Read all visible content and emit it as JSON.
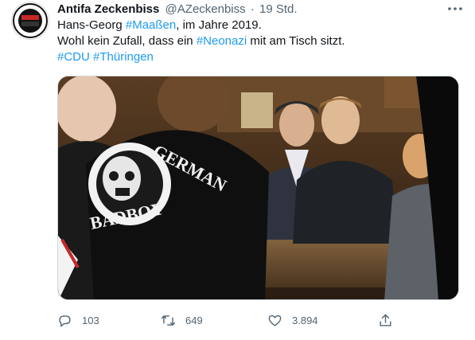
{
  "tweet": {
    "author_name": "Antifa Zeckenbiss",
    "handle": "@AZeckenbiss",
    "separator": "·",
    "time": "19 Std.",
    "line1_prefix": "Hans-Georg ",
    "line1_tag": "#Maaßen",
    "line1_suffix": ", im Jahre 2019.",
    "line2_prefix": "Wohl kein Zufall, dass ein ",
    "line2_tag": "#Neonazi",
    "line2_suffix": " mit am Tisch sitzt.",
    "tag_cdu": "#CDU",
    "tag_thueringen": "#Thüringen",
    "jacket_text_top": "GERMAN",
    "jacket_text_bottom": "BADBOY"
  },
  "actions": {
    "replies": "103",
    "retweets": "649",
    "likes": "3.894"
  },
  "colors": {
    "link": "#1d9bf0",
    "muted": "#536471",
    "text": "#0f1419"
  },
  "icons": [
    "more-icon",
    "reply-icon",
    "retweet-icon",
    "like-icon",
    "share-icon"
  ]
}
